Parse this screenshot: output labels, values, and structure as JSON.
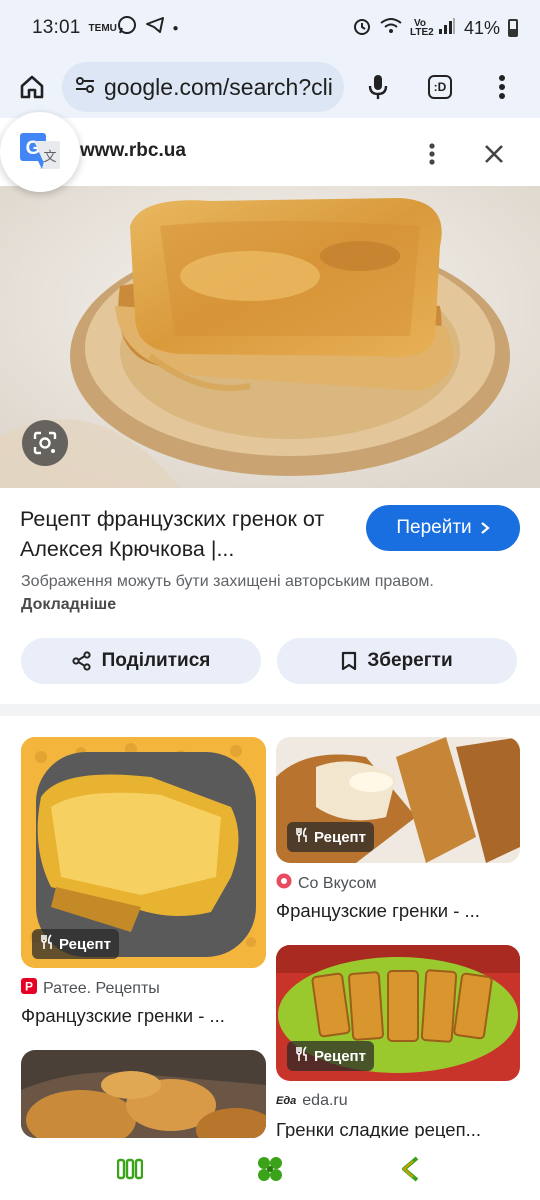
{
  "status_bar": {
    "time": "13:01",
    "mini_icon_text": "TEMU",
    "network_label": "Vo LTE2",
    "battery": "41%"
  },
  "toolbar": {
    "url": "google.com/search?client=ms-android",
    "tab_count": ":D"
  },
  "detail": {
    "site": "www.rbc.ua",
    "title": "Рецепт французских гренок от Алексея Крючкова |...",
    "visit_label": "Перейти",
    "copyright_text": "Зображення можуть бути захищені авторським правом.",
    "learn_more": "Докладніше",
    "share_label": "Поділитися",
    "save_label": "Зберегти"
  },
  "grid": {
    "recipe_chip": "Рецепт",
    "cards": [
      {
        "source": "Ратее. Рецепты",
        "title": "Французские гренки - ..."
      },
      {
        "source": "Со Вкусом",
        "title": "Французские гренки - ..."
      },
      {
        "source": "eda.ru",
        "source_mark": "Еда",
        "title": "Гренки сладкие рецеп..."
      }
    ]
  },
  "colors": {
    "accent": "#1a6fe0",
    "toolbar_bg": "#eef3fb",
    "nav_green": "#3aa31a",
    "nav_back": "#d0a000"
  }
}
